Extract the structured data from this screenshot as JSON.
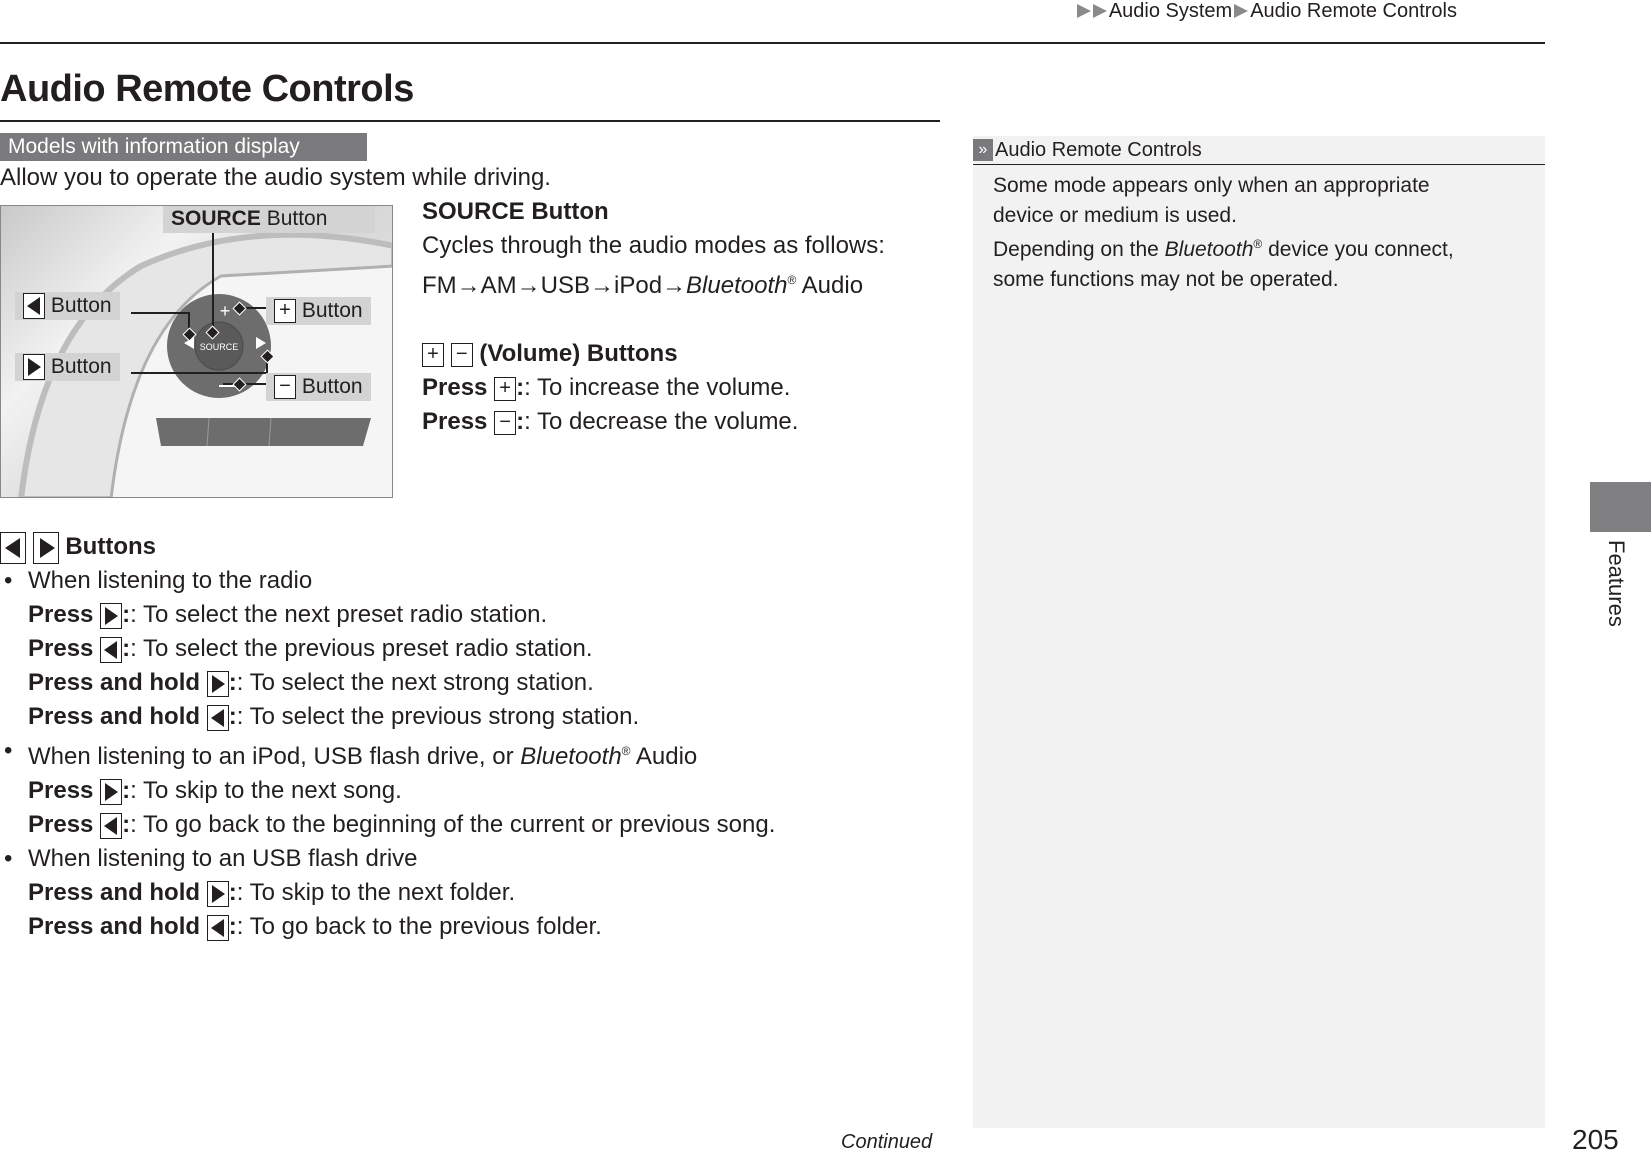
{
  "breadcrumb": {
    "items": [
      "Audio System",
      "Audio Remote Controls"
    ],
    "icon": "double-triangle-right-icon"
  },
  "page": {
    "title": "Audio Remote Controls",
    "model_tag": "Models with information display",
    "intro": "Allow you to operate the audio system while driving.",
    "continued": "Continued",
    "page_number": "205",
    "side_tab": "Features"
  },
  "figure": {
    "source_callout_bold": "SOURCE",
    "source_callout_rest": " Button",
    "left_callout": "Button",
    "right_callout": "Button",
    "plus_callout": "Button",
    "minus_callout": "Button",
    "plus_glyph": "+",
    "minus_glyph": "−",
    "center_label": "SOURCE"
  },
  "source_section": {
    "heading": "SOURCE Button",
    "desc": "Cycles through the audio modes as follows:",
    "cycle": "FM→AM→USB→iPod→",
    "cycle_bt": "Bluetooth",
    "cycle_reg": "®",
    "cycle_end": " Audio"
  },
  "volume_section": {
    "plus_glyph": "+",
    "minus_glyph": "−",
    "heading": "(Volume) Buttons",
    "press": "Press",
    "increase": ": To increase the volume.",
    "decrease": ": To decrease the volume."
  },
  "nav_section": {
    "heading": "Buttons",
    "press": "Press",
    "press_hold": "Press and hold",
    "bullet1": "When listening to the radio",
    "b1_next_preset": ": To select the next preset radio station.",
    "b1_prev_preset": ": To select the previous preset radio station.",
    "b1_next_strong": ": To select the next strong station.",
    "b1_prev_strong": ": To select the previous strong station.",
    "bullet2_pre": "When listening to an iPod, USB flash drive, or ",
    "bullet2_bt": "Bluetooth",
    "bullet2_reg": "®",
    "bullet2_post": " Audio",
    "b2_next": ": To skip to the next song.",
    "b2_prev": ": To go back to the beginning of the current or previous song.",
    "bullet3": "When listening to an USB flash drive",
    "b3_next": ": To skip to the next folder.",
    "b3_prev": ": To go back to the previous folder."
  },
  "sidebar_note": {
    "icon": "»",
    "title": "Audio Remote Controls",
    "line1": "Some mode appears only when an appropriate",
    "line2": "device or medium is used.",
    "line3_pre": "Depending on the ",
    "line3_bt": "Bluetooth",
    "line3_reg": "®",
    "line3_post": " device you connect,",
    "line4": "some functions may not be operated."
  }
}
